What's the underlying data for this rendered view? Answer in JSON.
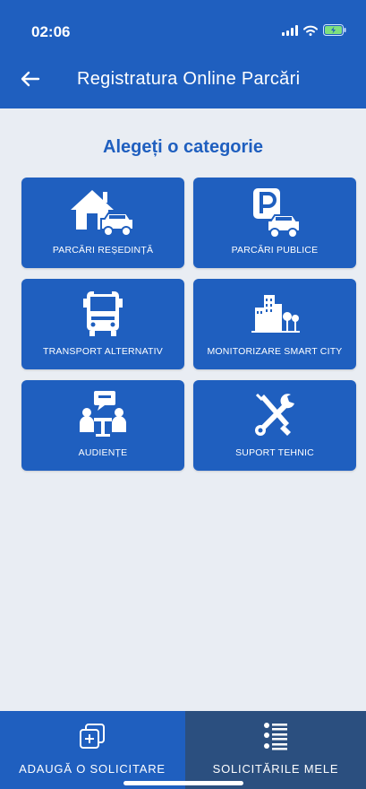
{
  "status_bar": {
    "time": "02:06"
  },
  "app_bar": {
    "title": "Registratura Online Parcări",
    "back_icon": "arrow-left-icon"
  },
  "heading": "Alegeți o categorie",
  "categories": [
    {
      "label": "PARCĂRI REȘEDINȚĂ",
      "icon": "house-car-icon"
    },
    {
      "label": "PARCĂRI PUBLICE",
      "icon": "parking-car-icon"
    },
    {
      "label": "TRANSPORT ALTERNATIV",
      "icon": "bus-icon"
    },
    {
      "label": "MONITORIZARE SMART CITY",
      "icon": "city-buildings-icon"
    },
    {
      "label": "AUDIENȚE",
      "icon": "meeting-icon"
    },
    {
      "label": "SUPORT TEHNIC",
      "icon": "tools-icon"
    }
  ],
  "bottom_nav": {
    "add_label": "ADAUGĂ O SOLICITARE",
    "mine_label": "SOLICITĂRILE MELE",
    "add_icon": "add-copy-icon",
    "mine_icon": "list-icon",
    "active": "SOLICITĂRILE MELE"
  },
  "colors": {
    "primary": "#1f5fbf",
    "background": "#e9edf3",
    "active_nav": "#2b4f7f"
  }
}
